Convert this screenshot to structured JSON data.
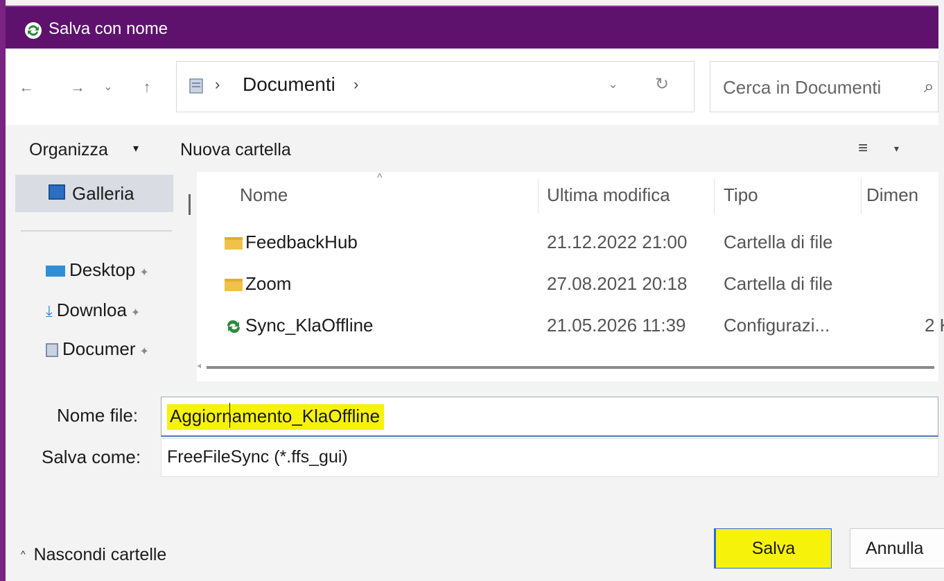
{
  "window": {
    "title": "Salva con nome",
    "title_icon": "sync-icon",
    "titlebar_color": "#5e126e"
  },
  "nav": {
    "back": "←",
    "forward": "→",
    "recent": "⌄",
    "up": "↑",
    "breadcrumb": [
      "Documenti"
    ],
    "breadcrumb_sep": "›",
    "dropdown": "⌄",
    "refresh": "↻",
    "search_placeholder": "Cerca in Documenti"
  },
  "toolbar": {
    "organize": "Organizza",
    "new_folder": "Nuova cartella"
  },
  "sidebar": {
    "items": [
      {
        "label": "Galleria",
        "icon": "gallery-icon",
        "selected": true
      },
      {
        "label": "Desktop",
        "icon": "desktop-icon",
        "pinned": true
      },
      {
        "label": "Downloa",
        "icon": "download-icon",
        "pinned": true
      },
      {
        "label": "Documer",
        "icon": "documents-icon",
        "pinned": true
      }
    ]
  },
  "files": {
    "columns": [
      "Nome",
      "Ultima modifica",
      "Tipo",
      "Dimen"
    ],
    "rows": [
      {
        "name": "FeedbackHub",
        "modified": "21.12.2022 21:00",
        "type": "Cartella di file",
        "size": "",
        "icon": "folder-icon"
      },
      {
        "name": "Zoom",
        "modified": "27.08.2021 20:18",
        "type": "Cartella di file",
        "size": "",
        "icon": "folder-icon"
      },
      {
        "name": "Sync_KlaOffline",
        "modified": "21.05.2026 11:39",
        "type": "Configurazi...",
        "size": "2 K",
        "icon": "sync-icon"
      }
    ]
  },
  "form": {
    "filename_label": "Nome file:",
    "filename_value": "Aggiornamento_KlaOffline",
    "savetype_label": "Salva come:",
    "savetype_value": "FreeFileSync (*.ffs_gui)"
  },
  "footer": {
    "hide_folders": "Nascondi cartelle",
    "save": "Salva",
    "cancel": "Annulla"
  },
  "colors": {
    "highlight": "#f7f20a",
    "accent": "#2f6bd1"
  }
}
